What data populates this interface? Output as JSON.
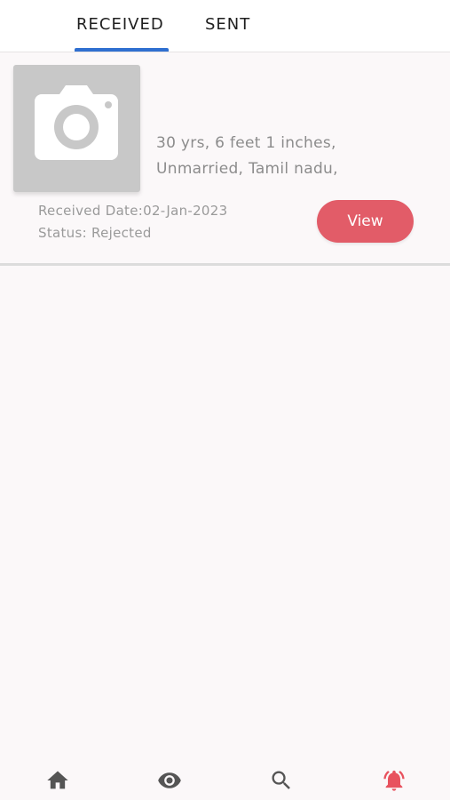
{
  "tabs": {
    "received": "RECEIVED",
    "sent": "SENT",
    "active": "received"
  },
  "card": {
    "photo_icon": "camera-icon",
    "info_line1": "30 yrs, 6 feet 1 inches,",
    "info_line2": "Unmarried, Tamil nadu,",
    "received_date": "Received Date:02-Jan-2023",
    "status": "Status: Rejected",
    "view_label": "View"
  },
  "bottom_nav": {
    "items": [
      {
        "icon": "home-icon"
      },
      {
        "icon": "eye-icon"
      },
      {
        "icon": "search-icon"
      },
      {
        "icon": "bell-alarm-icon",
        "active": true
      }
    ]
  },
  "colors": {
    "tab_indicator": "#2f6fd0",
    "view_button": "#e25c68",
    "nav_icon": "#555555",
    "nav_active": "#e8525e",
    "photo_placeholder": "#c8c8c8"
  }
}
